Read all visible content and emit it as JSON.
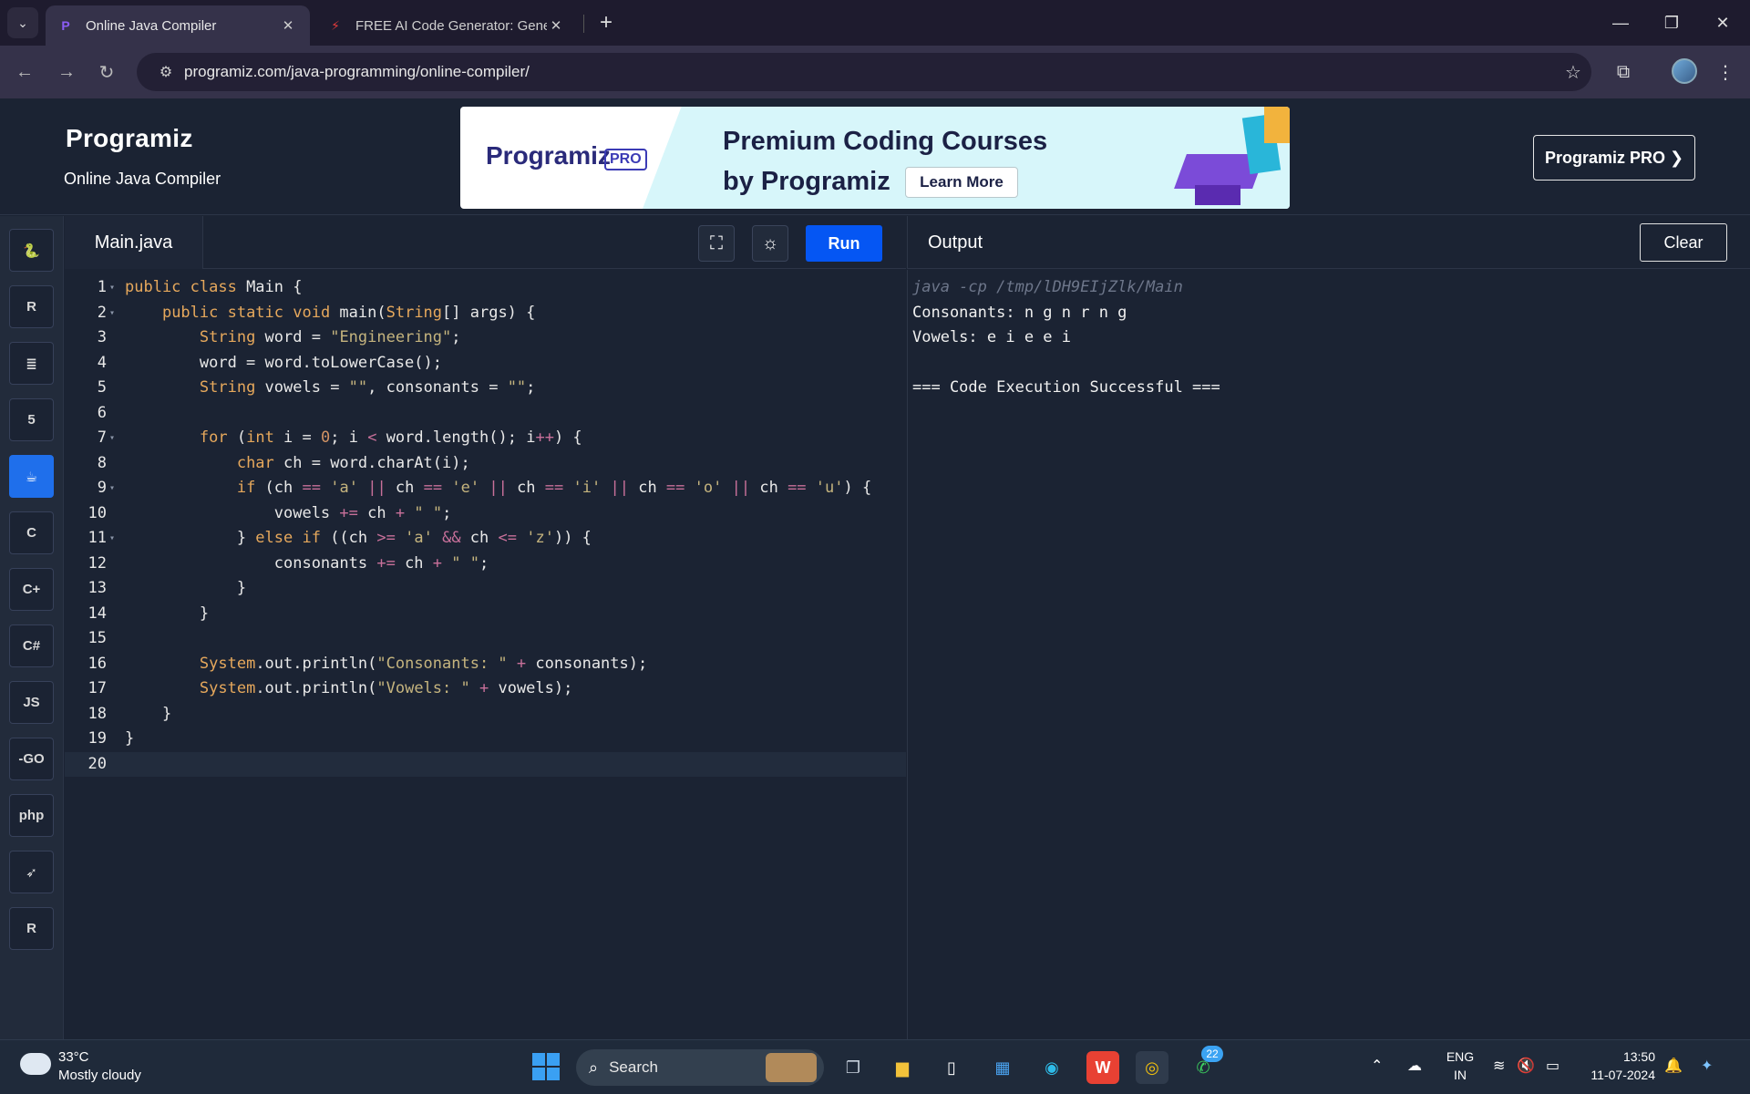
{
  "browser": {
    "tabs": [
      {
        "title": "Online Java Compiler",
        "active": true
      },
      {
        "title": "FREE AI Code Generator: Gener",
        "active": false
      }
    ],
    "url": "programiz.com/java-programming/online-compiler/"
  },
  "header": {
    "logo": "Programiz",
    "subtitle": "Online Java Compiler",
    "banner": {
      "logo": "Programiz",
      "badge": "PRO",
      "line1": "Premium Coding Courses",
      "line2": "by Programiz",
      "button": "Learn More"
    },
    "pro_button": "Programiz PRO ❯"
  },
  "rail": {
    "languages": [
      {
        "name": "python",
        "glyph": "🐍",
        "active": false
      },
      {
        "name": "r",
        "glyph": "R",
        "active": false
      },
      {
        "name": "sql",
        "glyph": "≣",
        "active": false
      },
      {
        "name": "html",
        "glyph": "5",
        "active": false
      },
      {
        "name": "java",
        "glyph": "☕",
        "active": true
      },
      {
        "name": "c",
        "glyph": "C",
        "active": false
      },
      {
        "name": "cpp",
        "glyph": "C+",
        "active": false
      },
      {
        "name": "csharp",
        "glyph": "C#",
        "active": false
      },
      {
        "name": "javascript",
        "glyph": "JS",
        "active": false
      },
      {
        "name": "go",
        "glyph": "-GO",
        "active": false
      },
      {
        "name": "php",
        "glyph": "php",
        "active": false
      },
      {
        "name": "swift",
        "glyph": "➶",
        "active": false
      },
      {
        "name": "rust",
        "glyph": "R",
        "active": false
      }
    ]
  },
  "editor": {
    "file_tab": "Main.java",
    "run_label": "Run",
    "lines": [
      {
        "n": "1",
        "fold": true,
        "code": "<span class=\"kw\">public class</span> Main {"
      },
      {
        "n": "2",
        "fold": true,
        "code": "    <span class=\"kw\">public static void</span> main(<span class=\"kw\">String</span>[] args) {"
      },
      {
        "n": "3",
        "fold": false,
        "code": "        <span class=\"kw\">String</span> word = <span class=\"st\">\"Engineering\"</span>;"
      },
      {
        "n": "4",
        "fold": false,
        "code": "        word = word.toLowerCase();"
      },
      {
        "n": "5",
        "fold": false,
        "code": "        <span class=\"kw\">String</span> vowels = <span class=\"st\">\"\"</span>, consonants = <span class=\"st\">\"\"</span>;"
      },
      {
        "n": "6",
        "fold": false,
        "code": ""
      },
      {
        "n": "7",
        "fold": true,
        "code": "        <span class=\"kw\">for</span> (<span class=\"kw\">int</span> i = <span class=\"nu\">0</span>; i <span class=\"op\">&lt;</span> word.length(); i<span class=\"op\">++</span>) {"
      },
      {
        "n": "8",
        "fold": false,
        "code": "            <span class=\"kw\">char</span> ch = word.charAt(i);"
      },
      {
        "n": "9",
        "fold": true,
        "code": "            <span class=\"kw\">if</span> (ch <span class=\"op\">==</span> <span class=\"st\">'a'</span> <span class=\"op\">||</span> ch <span class=\"op\">==</span> <span class=\"st\">'e'</span> <span class=\"op\">||</span> ch <span class=\"op\">==</span> <span class=\"st\">'i'</span> <span class=\"op\">||</span> ch <span class=\"op\">==</span> <span class=\"st\">'o'</span> <span class=\"op\">||</span> ch <span class=\"op\">==</span> <span class=\"st\">'u'</span>) {"
      },
      {
        "n": "10",
        "fold": false,
        "code": "                vowels <span class=\"op\">+=</span> ch <span class=\"op\">+</span> <span class=\"st\">\" \"</span>;"
      },
      {
        "n": "11",
        "fold": true,
        "code": "            } <span class=\"kw\">else if</span> ((ch <span class=\"op\">&gt;=</span> <span class=\"st\">'a'</span> <span class=\"op\">&amp;&amp;</span> ch <span class=\"op\">&lt;=</span> <span class=\"st\">'z'</span>)) {"
      },
      {
        "n": "12",
        "fold": false,
        "code": "                consonants <span class=\"op\">+=</span> ch <span class=\"op\">+</span> <span class=\"st\">\" \"</span>;"
      },
      {
        "n": "13",
        "fold": false,
        "code": "            }"
      },
      {
        "n": "14",
        "fold": false,
        "code": "        }"
      },
      {
        "n": "15",
        "fold": false,
        "code": ""
      },
      {
        "n": "16",
        "fold": false,
        "code": "        <span class=\"kw\">System</span>.out.println(<span class=\"st\">\"Consonants: \"</span> <span class=\"op\">+</span> consonants);"
      },
      {
        "n": "17",
        "fold": false,
        "code": "        <span class=\"kw\">System</span>.out.println(<span class=\"st\">\"Vowels: \"</span> <span class=\"op\">+</span> vowels);"
      },
      {
        "n": "18",
        "fold": false,
        "code": "    }"
      },
      {
        "n": "19",
        "fold": false,
        "code": "}"
      },
      {
        "n": "20",
        "fold": false,
        "code": ""
      }
    ]
  },
  "output": {
    "title": "Output",
    "clear_label": "Clear",
    "lines": [
      {
        "text": "java -cp /tmp/lDH9EIjZlk/Main",
        "kind": "cmd"
      },
      {
        "text": "Consonants: n g n r n g",
        "kind": "out"
      },
      {
        "text": "Vowels: e i e e i",
        "kind": "out"
      },
      {
        "text": "",
        "kind": "out"
      },
      {
        "text": "=== Code Execution Successful ===",
        "kind": "out"
      }
    ]
  },
  "taskbar": {
    "temperature": "33°C",
    "weather": "Mostly cloudy",
    "search_label": "Search",
    "language": "ENG",
    "region": "IN",
    "time": "13:50",
    "date": "11-07-2024",
    "whatsapp_badge": "22"
  }
}
